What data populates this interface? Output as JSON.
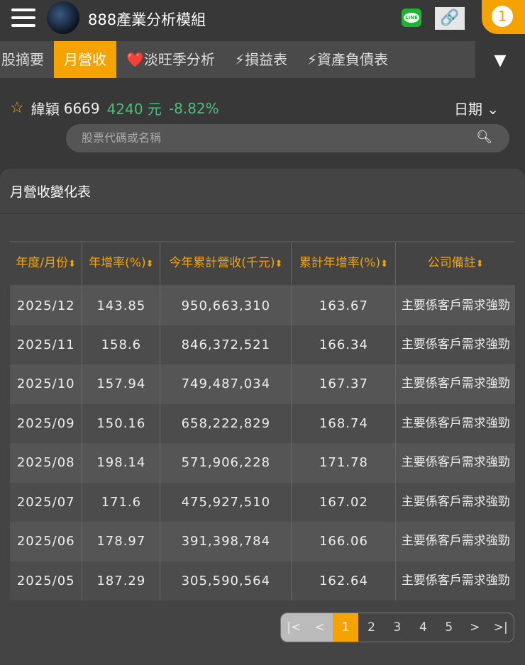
{
  "header": {
    "title": "888產業分析模組",
    "line_label": "LINE",
    "notification_count": "1"
  },
  "tabs": [
    {
      "label": "股摘要",
      "active": false
    },
    {
      "label": "月營收",
      "active": true
    },
    {
      "label": "❤️淡旺季分析",
      "active": false
    },
    {
      "label": "⚡損益表",
      "active": false
    },
    {
      "label": "⚡資產負債表",
      "active": false
    }
  ],
  "stock": {
    "name": "緯穎",
    "code": "6669",
    "price": "4240 元",
    "change": "-8.82%",
    "date_label": "日期"
  },
  "search": {
    "placeholder": "股票代碼或名稱"
  },
  "card": {
    "title": "月營收變化表"
  },
  "table": {
    "headers": [
      "年度/月份",
      "年增率(%)",
      "今年累計營收(千元)",
      "累計年增率(%)",
      "公司備註"
    ],
    "rows": [
      [
        "2025/12",
        "143.85",
        "950,663,310",
        "163.67",
        "主要係客戶需求強勁"
      ],
      [
        "2025/11",
        "158.6",
        "846,372,521",
        "166.34",
        "主要係客戶需求強勁"
      ],
      [
        "2025/10",
        "157.94",
        "749,487,034",
        "167.37",
        "主要係客戶需求強勁"
      ],
      [
        "2025/09",
        "150.16",
        "658,222,829",
        "168.74",
        "主要係客戶需求強勁"
      ],
      [
        "2025/08",
        "198.14",
        "571,906,228",
        "171.78",
        "主要係客戶需求強勁"
      ],
      [
        "2025/07",
        "171.6",
        "475,927,510",
        "167.02",
        "主要係客戶需求強勁"
      ],
      [
        "2025/06",
        "178.97",
        "391,398,784",
        "166.06",
        "主要係客戶需求強勁"
      ],
      [
        "2025/05",
        "187.29",
        "305,590,564",
        "162.64",
        "主要係客戶需求強勁"
      ]
    ]
  },
  "pager": [
    "|<",
    "<",
    "1",
    "2",
    "3",
    "4",
    "5",
    ">",
    ">|"
  ],
  "colors": {
    "accent": "#f5a300",
    "positive": "#4cbf7a"
  }
}
